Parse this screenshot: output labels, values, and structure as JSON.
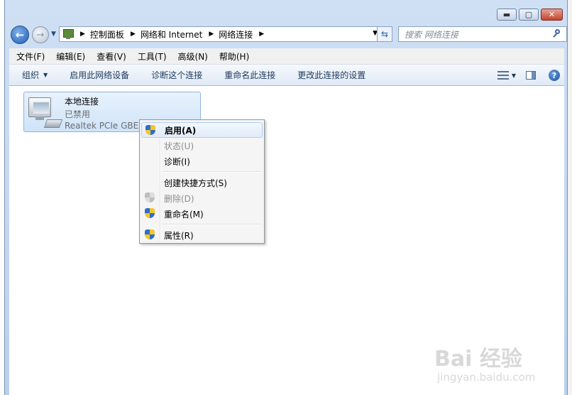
{
  "window": {
    "caption": {
      "minimize": "▬",
      "maximize": "▢",
      "close": "✕"
    }
  },
  "address": {
    "breadcrumbs": [
      "控制面板",
      "网络和 Internet",
      "网络连接"
    ],
    "search_placeholder": "搜索 网络连接"
  },
  "menu": [
    "文件(F)",
    "编辑(E)",
    "查看(V)",
    "工具(T)",
    "高级(N)",
    "帮助(H)"
  ],
  "toolbar": {
    "organize": "组织",
    "enable": "启用此网络设备",
    "diagnose": "诊断这个连接",
    "rename": "重命名此连接",
    "change_settings": "更改此连接的设置",
    "help": "?"
  },
  "connection": {
    "name": "本地连接",
    "status": "已禁用",
    "device": "Realtek PCIe GBE"
  },
  "context_menu": {
    "items": [
      {
        "label": "启用(A)",
        "icon": "shield-icon"
      },
      {
        "label": "状态(U)"
      },
      {
        "label": "诊断(I)"
      },
      {
        "label": "创建快捷方式(S)"
      },
      {
        "label": "删除(D)",
        "icon": "shield-icon"
      },
      {
        "label": "重命名(M)",
        "icon": "shield-icon"
      },
      {
        "label": "属性(R)",
        "icon": "shield-icon"
      }
    ]
  },
  "watermark": {
    "main": "Bai  经验",
    "sub": "jingyan.baidu.com"
  },
  "colors": {
    "accent": "#1e395b",
    "tile_border": "#8fb3df",
    "highlight_border": "#aecff7"
  }
}
